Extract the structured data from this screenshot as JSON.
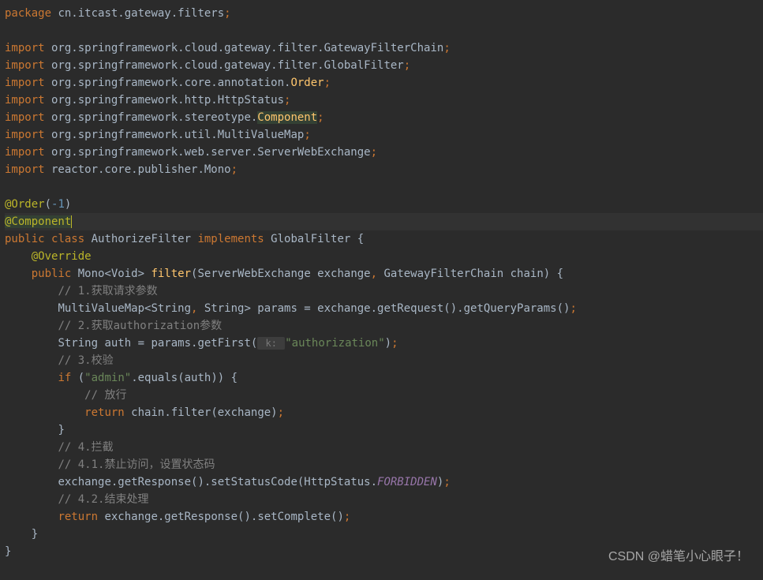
{
  "code": {
    "l1": {
      "kw": "package",
      "rest": " cn.itcast.gateway.filters",
      "semi": ";"
    },
    "l3": {
      "kw": "import",
      "rest": " org.springframework.cloud.gateway.filter.GatewayFilterChain",
      "semi": ";"
    },
    "l4": {
      "kw": "import",
      "rest": " org.springframework.cloud.gateway.filter.GlobalFilter",
      "semi": ";"
    },
    "l5": {
      "kw": "import",
      "pre": " org.springframework.core.annotation.",
      "cls": "Order",
      "semi": ";"
    },
    "l6": {
      "kw": "import",
      "rest": " org.springframework.http.HttpStatus",
      "semi": ";"
    },
    "l7": {
      "kw": "import",
      "pre": " org.springframework.stereotype.",
      "cls": "Component",
      "semi": ";"
    },
    "l8": {
      "kw": "import",
      "rest": " org.springframework.util.MultiValueMap",
      "semi": ";"
    },
    "l9": {
      "kw": "import",
      "rest": " org.springframework.web.server.ServerWebExchange",
      "semi": ";"
    },
    "l10": {
      "kw": "import",
      "rest": " reactor.core.publisher.Mono",
      "semi": ";"
    },
    "order_anno": {
      "at": "@Order",
      "open": "(",
      "neg": "-1",
      "close": ")"
    },
    "component_anno": {
      "at": "@Component"
    },
    "class_decl": {
      "pub": "public ",
      "cls": "class ",
      "name": "AuthorizeFilter ",
      "impl": "implements ",
      "iface": "GlobalFilter ",
      "brace": "{"
    },
    "override": {
      "at": "@Override"
    },
    "method_decl": {
      "pub": "public ",
      "ret": "Mono<Void> ",
      "name": "filter",
      "sig": "(ServerWebExchange exchange",
      "comma": ", ",
      "sig2": "GatewayFilterChain chain) ",
      "brace": "{"
    },
    "c1": "// 1.获取请求参数",
    "params_line": {
      "type": "MultiValueMap<String",
      "comma": ", ",
      "type2": "String> params = exchange.getRequest().getQueryParams()",
      "semi": ";"
    },
    "c2": "// 2.获取authorization参数",
    "auth_line": {
      "pre": "String auth = params.getFirst(",
      "hint": " k: ",
      "str": "\"authorization\"",
      "post": ")",
      "semi": ";"
    },
    "c3": "// 3.校验",
    "if_line": {
      "kw": "if ",
      "open": "(",
      "str": "\"admin\"",
      "rest": ".equals(auth)) ",
      "brace": "{"
    },
    "c4": "// 放行",
    "return1": {
      "kw": "return ",
      "rest": "chain.filter(exchange)",
      "semi": ";"
    },
    "close_if": "}",
    "c5": "// 4.拦截",
    "c6": "// 4.1.禁止访问，设置状态码",
    "status_line": {
      "pre": "exchange.getResponse().setStatusCode(HttpStatus.",
      "mem": "FORBIDDEN",
      "post": ")",
      "semi": ";"
    },
    "c7": "// 4.2.结束处理",
    "return2": {
      "kw": "return ",
      "rest": "exchange.getResponse().setComplete()",
      "semi": ";"
    },
    "close_method": "}",
    "close_class": "}"
  },
  "watermark": "CSDN @蜡笔小心眼子！"
}
